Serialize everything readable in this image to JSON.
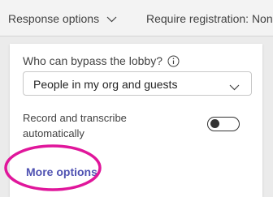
{
  "toolbar": {
    "response_options": "Response options",
    "require_registration": "Require registration: Non"
  },
  "lobby": {
    "label": "Who can bypass the lobby?",
    "selected": "People in my org and guests"
  },
  "recording": {
    "label": "Record and transcribe automatically",
    "enabled": false
  },
  "more_options": "More options",
  "colors": {
    "link": "#4f52b2",
    "highlight": "#e0169b"
  },
  "icons": [
    "chevron-down-icon",
    "info-icon",
    "toggle-knob"
  ]
}
